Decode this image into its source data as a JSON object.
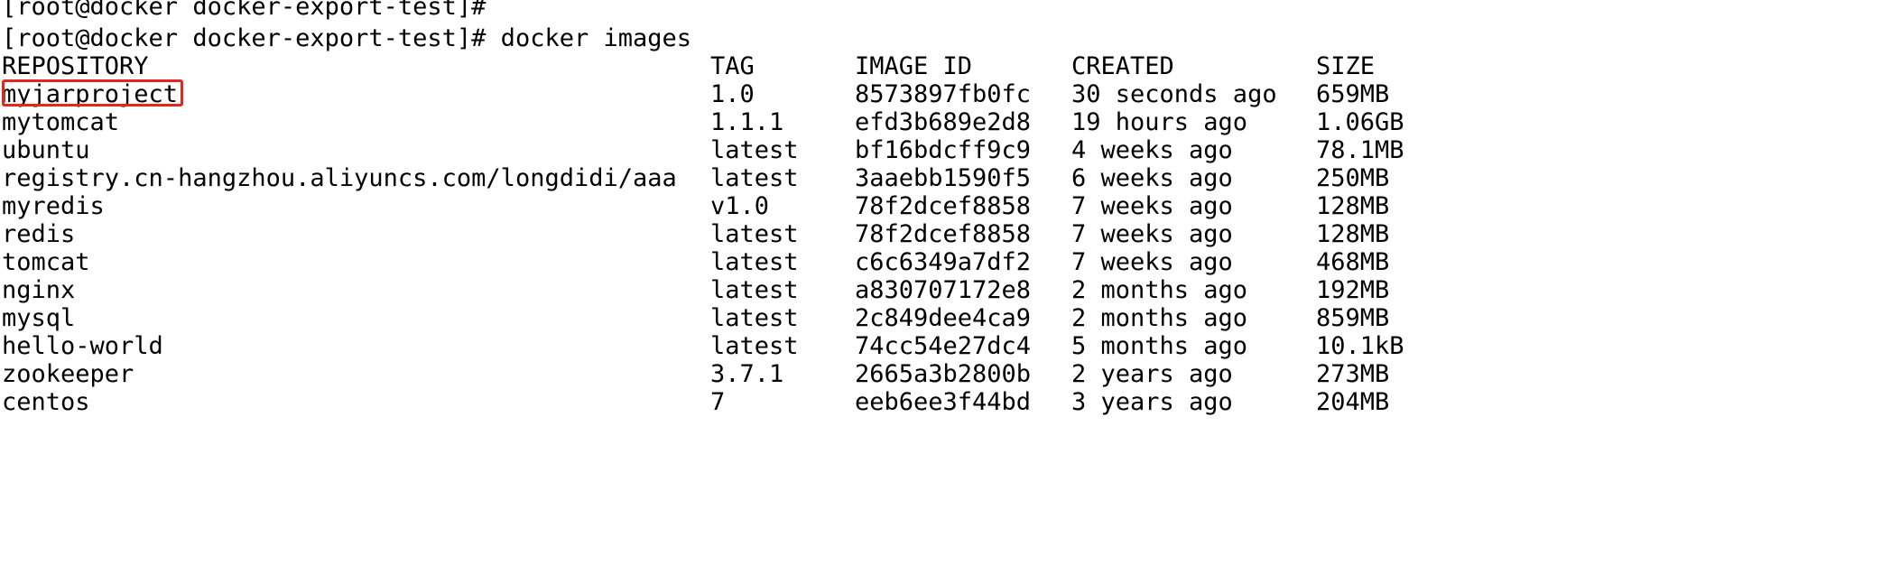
{
  "terminal": {
    "prompt_lines": [
      "[root@docker docker-export-test]#",
      "[root@docker docker-export-test]# docker images"
    ],
    "headers": {
      "repository": "REPOSITORY",
      "tag": "TAG",
      "image_id": "IMAGE ID",
      "created": "CREATED",
      "size": "SIZE"
    },
    "rows": [
      {
        "repository": "myjarproject",
        "tag": "1.0",
        "image_id": "8573897fb0fc",
        "created": "30 seconds ago",
        "size": "659MB"
      },
      {
        "repository": "mytomcat",
        "tag": "1.1.1",
        "image_id": "efd3b689e2d8",
        "created": "19 hours ago",
        "size": "1.06GB"
      },
      {
        "repository": "ubuntu",
        "tag": "latest",
        "image_id": "bf16bdcff9c9",
        "created": "4 weeks ago",
        "size": "78.1MB"
      },
      {
        "repository": "registry.cn-hangzhou.aliyuncs.com/longdidi/aaa",
        "tag": "latest",
        "image_id": "3aaebb1590f5",
        "created": "6 weeks ago",
        "size": "250MB"
      },
      {
        "repository": "myredis",
        "tag": "v1.0",
        "image_id": "78f2dcef8858",
        "created": "7 weeks ago",
        "size": "128MB"
      },
      {
        "repository": "redis",
        "tag": "latest",
        "image_id": "78f2dcef8858",
        "created": "7 weeks ago",
        "size": "128MB"
      },
      {
        "repository": "tomcat",
        "tag": "latest",
        "image_id": "c6c6349a7df2",
        "created": "7 weeks ago",
        "size": "468MB"
      },
      {
        "repository": "nginx",
        "tag": "latest",
        "image_id": "a830707172e8",
        "created": "2 months ago",
        "size": "192MB"
      },
      {
        "repository": "mysql",
        "tag": "latest",
        "image_id": "2c849dee4ca9",
        "created": "2 months ago",
        "size": "859MB"
      },
      {
        "repository": "hello-world",
        "tag": "latest",
        "image_id": "74cc54e27dc4",
        "created": "5 months ago",
        "size": "10.1kB"
      },
      {
        "repository": "zookeeper",
        "tag": "3.7.1",
        "image_id": "2665a3b2800b",
        "created": "2 years ago",
        "size": "273MB"
      },
      {
        "repository": "centos",
        "tag": "7",
        "image_id": "eeb6ee3f44bd",
        "created": "3 years ago",
        "size": "204MB"
      }
    ]
  },
  "colors": {
    "background": "#ffffff",
    "text": "#000000",
    "highlight_box": "#e0281c"
  }
}
